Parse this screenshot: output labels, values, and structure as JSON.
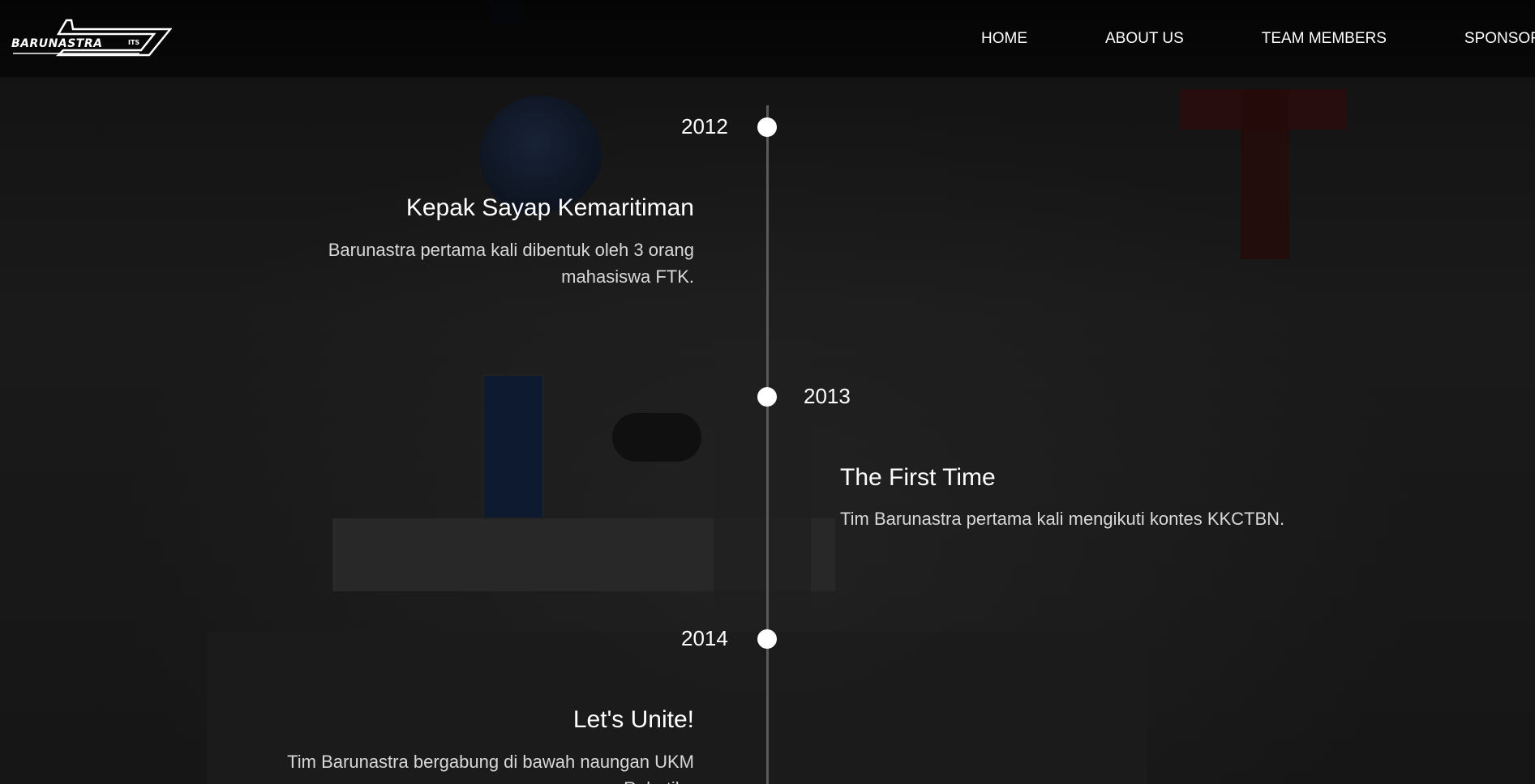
{
  "brand": {
    "logo_text": "BARUNASTRA",
    "logo_suffix": "ITS"
  },
  "nav": {
    "items": [
      {
        "label": "HOME"
      },
      {
        "label": "ABOUT US"
      },
      {
        "label": "TEAM MEMBERS"
      },
      {
        "label": "SPONSORS"
      }
    ]
  },
  "timeline": {
    "entries": [
      {
        "year": "2012",
        "title": "Kepak Sayap Kemaritiman",
        "description": "Barunastra pertama kali dibentuk oleh 3 orang mahasiswa FTK."
      },
      {
        "year": "2013",
        "title": "The First Time",
        "description": "Tim Barunastra pertama kali mengikuti kontes KKCTBN."
      },
      {
        "year": "2014",
        "title": "Let's Unite!",
        "description": "Tim Barunastra bergabung di bawah naungan UKM Robotika"
      }
    ]
  },
  "colors": {
    "background": "#151515",
    "text": "#ffffff",
    "description_text": "#d8d8d8",
    "timeline_line": "#5a5a5a",
    "dot": "#ffffff"
  }
}
